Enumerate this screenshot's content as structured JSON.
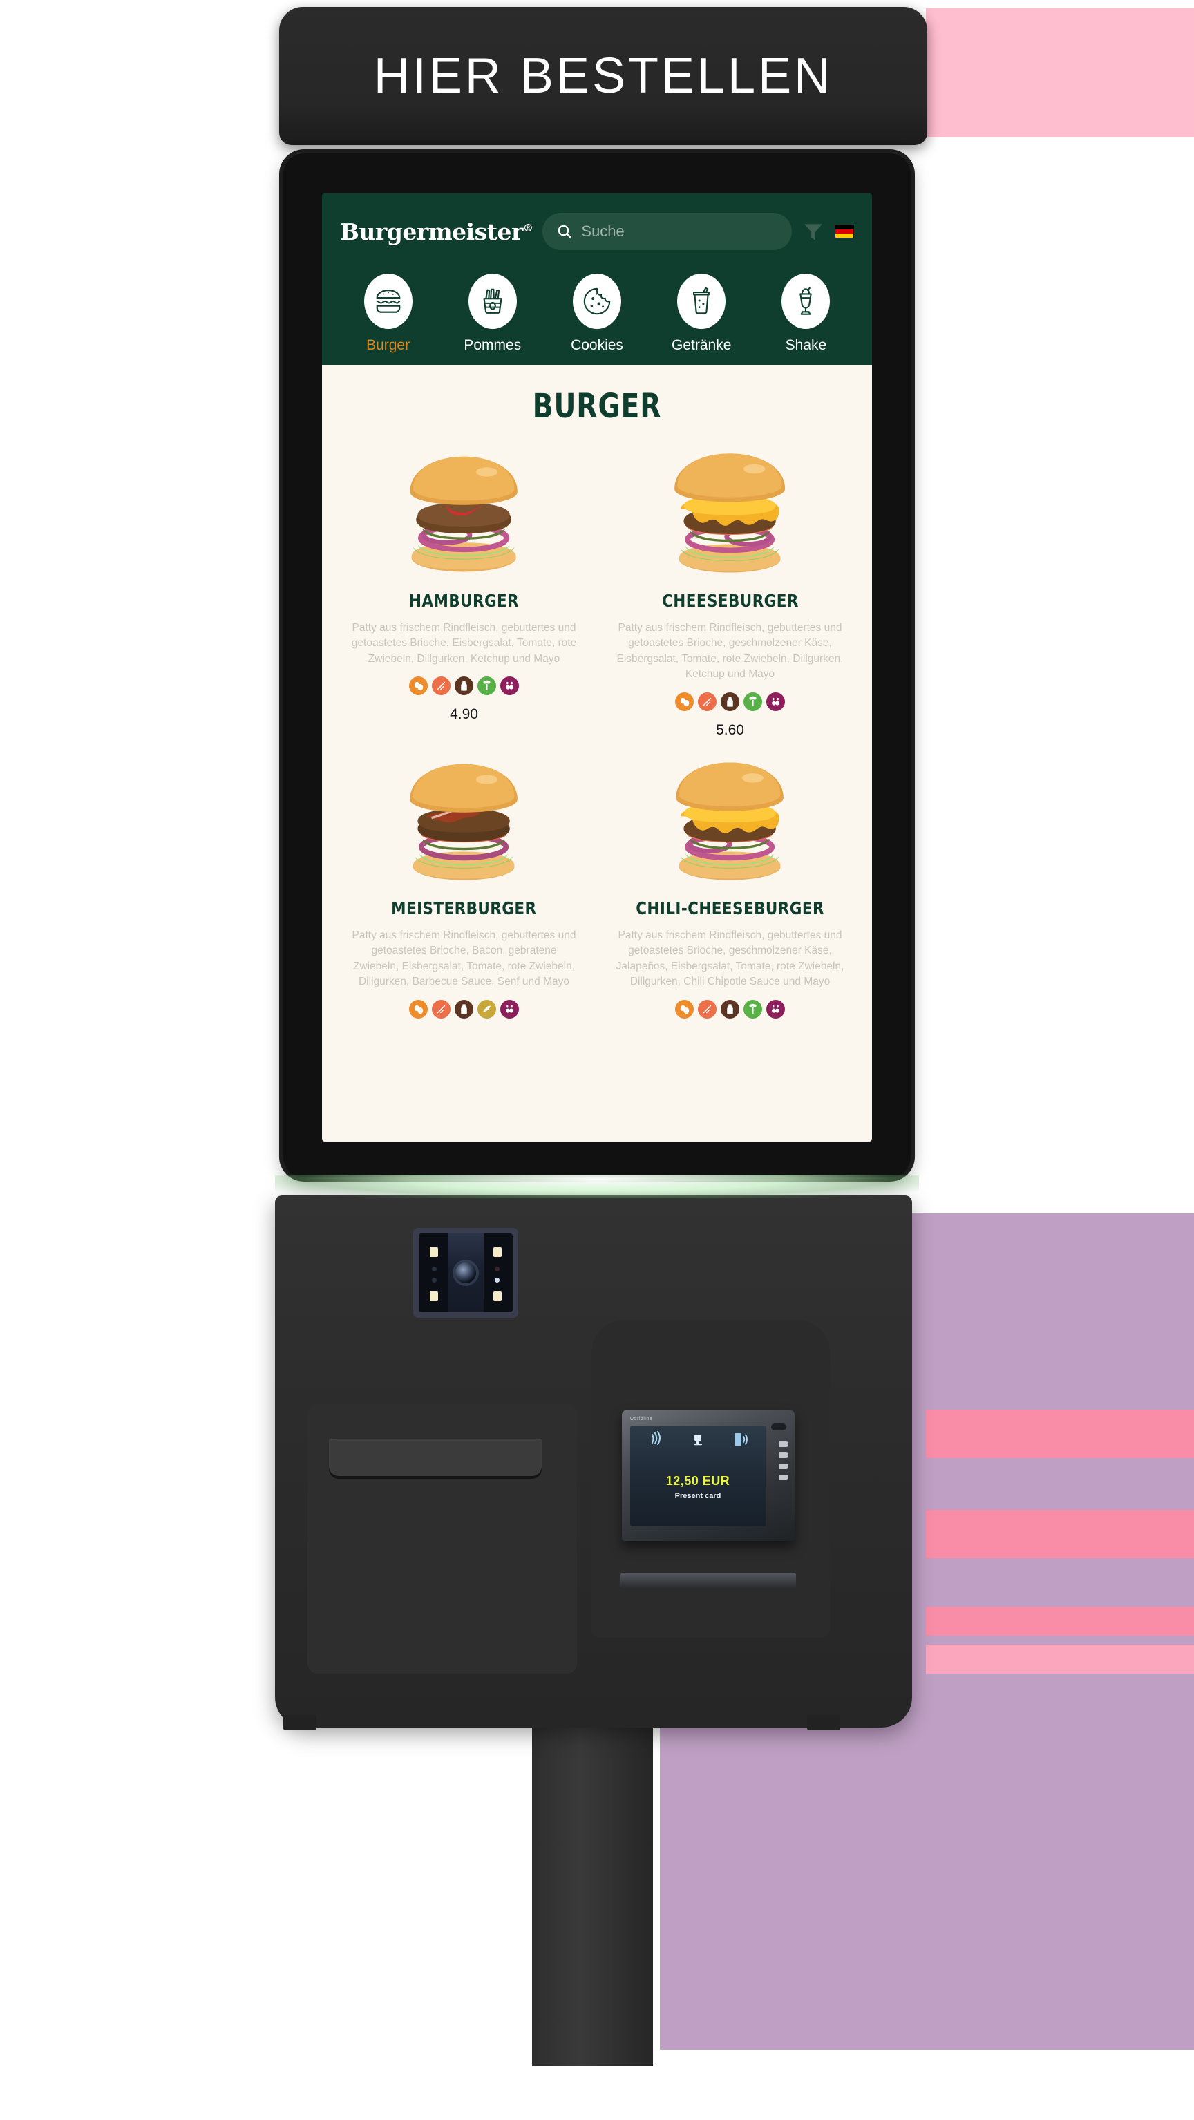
{
  "kiosk": {
    "header_text": "HIER BESTELLEN",
    "hardware": {
      "scanner_name": "qr-code-scanner",
      "printer_name": "receipt-printer-slot",
      "card_reader_name": "card-payment-terminal"
    }
  },
  "terminal": {
    "brand": "worldline",
    "amount": "12,50 EUR",
    "hint": "Present card",
    "icons": [
      "contactless-icon",
      "chip-card-icon",
      "nfc-phone-icon"
    ]
  },
  "app": {
    "brand": "Burgermeister",
    "brand_mark": "®",
    "search": {
      "placeholder": "Suche",
      "icon": "search-icon"
    },
    "filter_icon": "filter-funnel-icon",
    "language_flag": "german-flag-icon",
    "categories": [
      {
        "label": "Burger",
        "icon": "burger-icon",
        "active": true
      },
      {
        "label": "Pommes",
        "icon": "fries-icon",
        "active": false
      },
      {
        "label": "Cookies",
        "icon": "cookie-icon",
        "active": false
      },
      {
        "label": "Getränke",
        "icon": "drink-cup-icon",
        "active": false
      },
      {
        "label": "Shake",
        "icon": "milkshake-icon",
        "active": false
      }
    ],
    "section_title": "BURGER",
    "products": [
      {
        "name": "HAMBURGER",
        "description": "Patty aus frischem Rindfleisch, gebuttertes und getoastetes Brioche, Eisbergsalat, Tomate, rote Zwiebeln, Dillgurken, Ketchup und Mayo",
        "price": "4.90",
        "image": "hamburger-photo",
        "allergens": [
          "egg",
          "gluten",
          "milk",
          "celery",
          "mustard"
        ]
      },
      {
        "name": "CHEESEBURGER",
        "description": "Patty aus frischem Rindfleisch, gebuttertes und getoastetes Brioche, geschmolzener Käse, Eisbergsalat, Tomate, rote Zwiebeln, Dillgurken, Ketchup und Mayo",
        "price": "5.60",
        "image": "cheeseburger-photo",
        "allergens": [
          "egg",
          "gluten",
          "milk",
          "celery",
          "mustard"
        ]
      },
      {
        "name": "MEISTERBURGER",
        "description": "Patty aus frischem Rindfleisch, gebuttertes und getoastetes Brioche, Bacon, gebratene Zwiebeln, Eisbergsalat, Tomate, rote Zwiebeln, Dillgurken, Barbecue Sauce, Senf und Mayo",
        "price": "",
        "image": "meisterburger-photo",
        "allergens": [
          "egg",
          "gluten",
          "milk",
          "soy",
          "mustard"
        ]
      },
      {
        "name": "CHILI-CHEESEBURGER",
        "description": "Patty aus frischem Rindfleisch, gebuttertes und getoastetes Brioche, geschmolzener Käse, Jalapeños, Eisbergsalat, Tomate, rote Zwiebeln, Dillgurken, Chili Chipotle Sauce und Mayo",
        "price": "",
        "image": "chili-cheeseburger-photo",
        "allergens": [
          "egg",
          "gluten",
          "milk",
          "celery",
          "mustard"
        ]
      }
    ]
  },
  "colors": {
    "brand_green": "#0F3D2E",
    "menu_bg": "#FBF7EE",
    "active_category": "#D98B1E",
    "description_text": "#C9C5BC",
    "terminal_amount": "#E8F542",
    "band_pink": "#F98DA8",
    "band_purple": "#BFA0C4",
    "band_light_pink": "#FFBDD0"
  },
  "allergen_colors": {
    "egg": "#EE8C2B",
    "gluten": "#ED6F4A",
    "milk": "#5C3522",
    "celery": "#57B147",
    "mustard": "#8C1F5C",
    "soy": "#C8A83A"
  }
}
